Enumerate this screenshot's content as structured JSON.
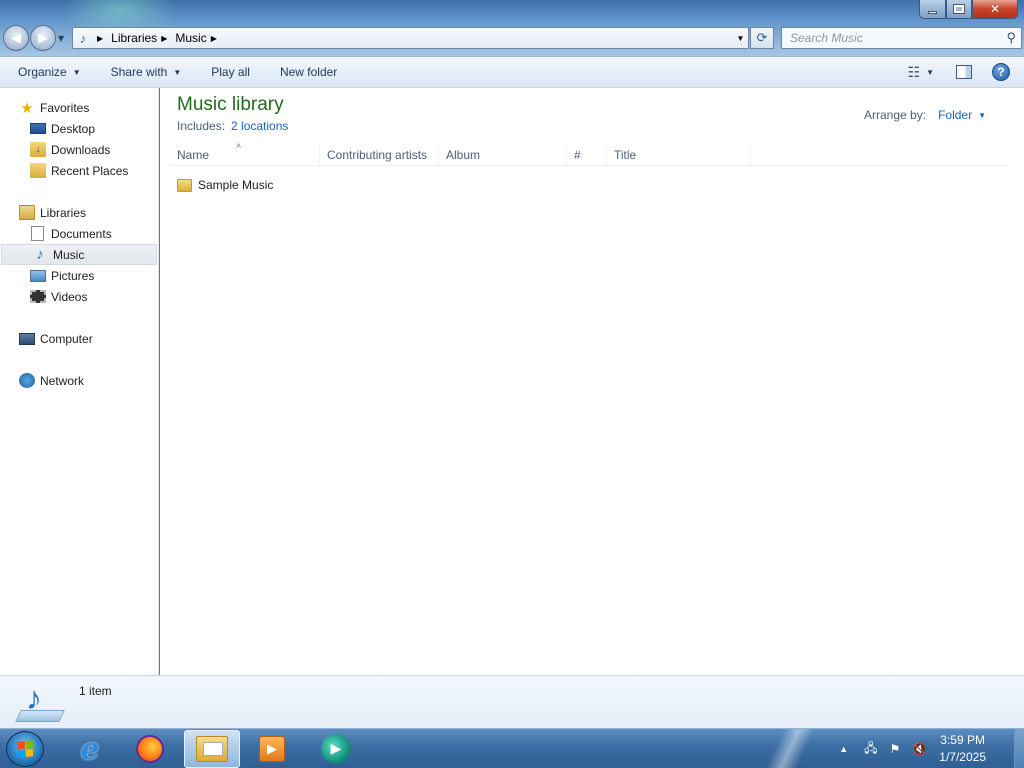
{
  "window": {
    "controls": {
      "minimize_icon": "minimize-icon",
      "maximize_icon": "maximize-icon",
      "close_icon": "close-icon"
    }
  },
  "navigation": {
    "back_icon": "back-arrow-icon",
    "forward_icon": "forward-arrow-icon"
  },
  "address": {
    "breadcrumbs": [
      "Libraries",
      "Music"
    ]
  },
  "search": {
    "placeholder": "Search Music"
  },
  "toolbar": {
    "organize_label": "Organize",
    "share_label": "Share with",
    "play_all_label": "Play all",
    "new_folder_label": "New folder"
  },
  "sidebar": {
    "favorites_label": "Favorites",
    "desktop_label": "Desktop",
    "downloads_label": "Downloads",
    "recent_label": "Recent Places",
    "libraries_label": "Libraries",
    "documents_label": "Documents",
    "music_label": "Music",
    "pictures_label": "Pictures",
    "videos_label": "Videos",
    "computer_label": "Computer",
    "network_label": "Network"
  },
  "library": {
    "title": "Music library",
    "includes_label": "Includes:",
    "locations_link": "2 locations",
    "arrange_label": "Arrange by:",
    "arrange_value": "Folder"
  },
  "columns": {
    "name": "Name",
    "artists": "Contributing artists",
    "album": "Album",
    "number": "#",
    "title": "Title"
  },
  "files": [
    {
      "name": "Sample Music",
      "type": "folder"
    }
  ],
  "details": {
    "count": "1 item"
  },
  "taskbar": {
    "time": "3:59 PM",
    "date": "1/7/2025"
  },
  "colors": {
    "library_title": "#1e6b1e",
    "link": "#1863c4"
  }
}
